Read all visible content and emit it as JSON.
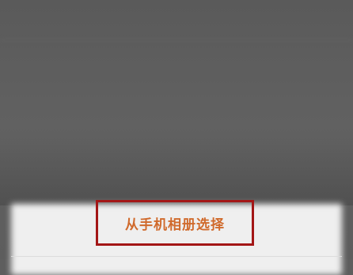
{
  "background_screen": {
    "title": "",
    "action": "",
    "hint": ""
  },
  "sheet": {
    "options": [
      {
        "label": "从手机相册选择",
        "color": "#d06a2c",
        "highlighted": true
      }
    ],
    "highlight_color": "#a31616"
  }
}
